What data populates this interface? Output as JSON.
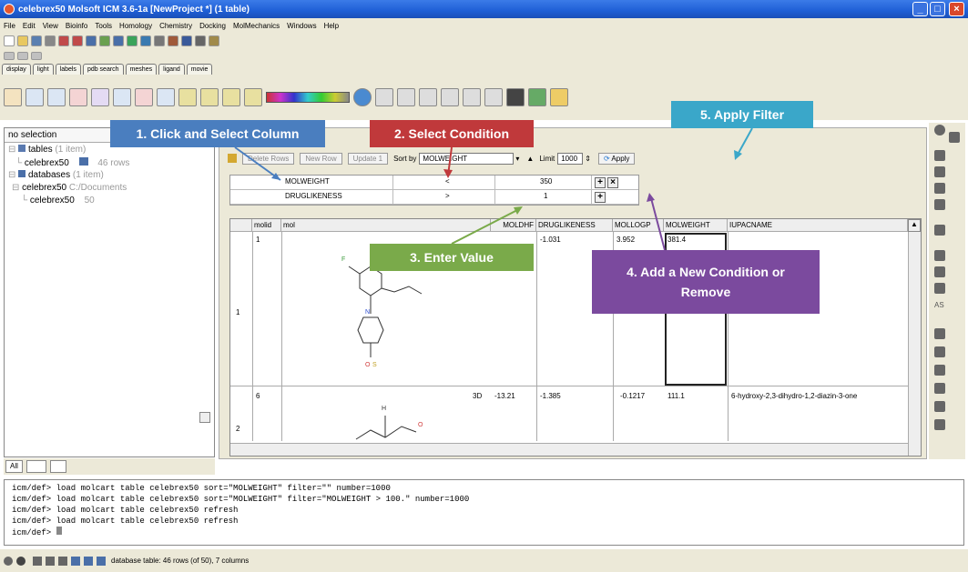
{
  "window": {
    "title": "celebrex50 Molsoft ICM 3.6-1a [NewProject *] (1 table)"
  },
  "menu": [
    "File",
    "Edit",
    "View",
    "Bioinfo",
    "Tools",
    "Homology",
    "Chemistry",
    "Docking",
    "MolMechanics",
    "Windows",
    "Help"
  ],
  "tabs": [
    "display",
    "light",
    "labels",
    "pdb search",
    "meshes",
    "ligand",
    "movie"
  ],
  "left_panel": {
    "selection": "no selection",
    "tree": [
      {
        "label": "tables",
        "detail": "(1 item)"
      },
      {
        "label": "celebrex50",
        "detail": "46 rows"
      },
      {
        "label": "databases",
        "detail": "(1 item)"
      },
      {
        "label": "celebrex50",
        "detail": "C:/Documents"
      },
      {
        "label": "celebrex50",
        "detail": "50"
      }
    ],
    "bottom_tabs": [
      "All"
    ]
  },
  "controls": {
    "delete_rows": "Delete Rows",
    "new_row": "New Row",
    "update": "Update 1",
    "sort_by_label": "Sort by",
    "sort_by_value": "MOLWEIGHT",
    "limit_label": "Limit",
    "limit_value": "1000",
    "apply": "Apply"
  },
  "conditions": [
    {
      "column": "MOLWEIGHT",
      "op": "<",
      "value": "350"
    },
    {
      "column": "DRUGLIKENESS",
      "op": ">",
      "value": "1"
    }
  ],
  "table": {
    "columns": [
      "molid",
      "mol",
      "MOLDHF",
      "DRUGLIKENESS",
      "MOLLOGP",
      "MOLWEIGHT",
      "IUPACNAME"
    ],
    "rows": [
      {
        "index": "1",
        "molid": "1",
        "extra": "",
        "moldhf": "",
        "druglikeness": "-1.031",
        "mollogp": "3.952",
        "molweight": "381.4",
        "iupac": ""
      },
      {
        "index": "2",
        "molid": "6",
        "extra": "3D",
        "moldhf": "-13.21",
        "druglikeness": "-1.385",
        "mollogp": "-0.1217",
        "molweight": "111.1",
        "iupac": "6-hydroxy-2,3-dihydro-1,2-diazin-3-one"
      }
    ]
  },
  "callouts": {
    "c1": "1. Click and Select Column",
    "c2": "2. Select Condition",
    "c3": "3. Enter Value",
    "c4": "4. Add a New Condition or Remove",
    "c5": "5. Apply Filter"
  },
  "console_lines": [
    "icm/def> load molcart table celebrex50 sort=\"MOLWEIGHT\" filter=\"\" number=1000",
    "icm/def> load molcart table celebrex50 sort=\"MOLWEIGHT\" filter=\"MOLWEIGHT > 100.\" number=1000",
    "icm/def> load molcart table celebrex50 refresh",
    "icm/def> load molcart table celebrex50 refresh",
    "icm/def> "
  ],
  "status": {
    "text": "database table: 46 rows (of 50), 7 columns"
  },
  "colors": {
    "callout_blue": "#4a7ebf",
    "callout_red": "#c0393b",
    "callout_green": "#7aaa4a",
    "callout_purple": "#7b4a9e",
    "callout_cyan": "#3aa7c9"
  }
}
